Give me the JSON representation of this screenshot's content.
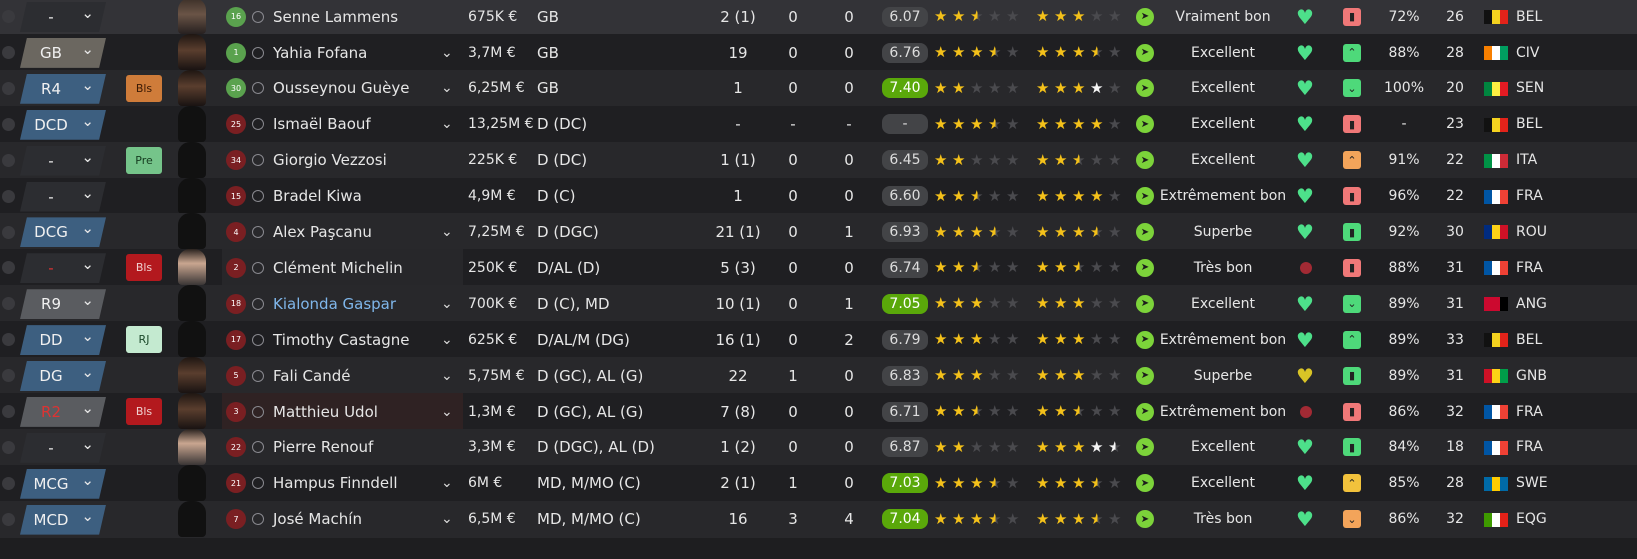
{
  "players": [
    {
      "pos": "-",
      "pos_style": "dark",
      "pos_red": false,
      "tag": "",
      "tag_style": "",
      "face": "photo",
      "shirt_no": "16",
      "gk": true,
      "name": "Senne Lammens",
      "link": false,
      "menu": false,
      "value": "675K €",
      "position": "GB",
      "apps": "2 (1)",
      "goals": "0",
      "assists": "0",
      "rating": "6.07",
      "rating_hi": false,
      "stars_ability": [
        "full",
        "full",
        "half",
        "empty",
        "empty"
      ],
      "stars_potential": [
        "full",
        "full",
        "full",
        "empty",
        "empty"
      ],
      "morale": "Vraiment bon",
      "heart": "green",
      "trend": "salmon",
      "trend_icon": "thumb-down-icon",
      "pct": "72%",
      "age": "26",
      "flag": [
        "#111111",
        "#f4d21f",
        "#e2231a"
      ],
      "nat": "BEL"
    },
    {
      "pos": "GB",
      "pos_style": "brown",
      "pos_red": false,
      "tag": "",
      "tag_style": "",
      "face": "photo2",
      "shirt_no": "1",
      "gk": true,
      "name": "Yahia Fofana",
      "link": false,
      "menu": true,
      "value": "3,7M €",
      "position": "GB",
      "apps": "19",
      "goals": "0",
      "assists": "0",
      "rating": "6.76",
      "rating_hi": false,
      "stars_ability": [
        "full",
        "full",
        "full",
        "half",
        "empty"
      ],
      "stars_potential": [
        "full",
        "full",
        "full",
        "half",
        "empty"
      ],
      "morale": "Excellent",
      "heart": "green",
      "trend": "green",
      "trend_icon": "up-icon",
      "pct": "88%",
      "age": "28",
      "flag": [
        "#f77f00",
        "#ffffff",
        "#009e60"
      ],
      "nat": "CIV"
    },
    {
      "pos": "R4",
      "pos_style": "blue",
      "pos_red": false,
      "tag": "Bls",
      "tag_style": "orange",
      "face": "photo2",
      "shirt_no": "30",
      "gk": true,
      "name": "Ousseynou Guèye",
      "link": false,
      "menu": true,
      "value": "6,25M €",
      "position": "GB",
      "apps": "1",
      "goals": "0",
      "assists": "0",
      "rating": "7.40",
      "rating_hi": true,
      "stars_ability": [
        "full",
        "full",
        "empty",
        "empty",
        "empty"
      ],
      "stars_potential": [
        "full",
        "full",
        "full",
        "white",
        "empty"
      ],
      "morale": "Excellent",
      "heart": "green",
      "trend": "green",
      "trend_icon": "down-icon",
      "pct": "100%",
      "age": "20",
      "flag": [
        "#00853f",
        "#fdef42",
        "#e31b23"
      ],
      "nat": "SEN"
    },
    {
      "pos": "DCD",
      "pos_style": "blue",
      "pos_red": false,
      "tag": "",
      "tag_style": "",
      "face": "",
      "shirt_no": "25",
      "gk": false,
      "name": "Ismaël Baouf",
      "link": false,
      "menu": true,
      "value": "13,25M €",
      "position": "D (DC)",
      "apps": "-",
      "goals": "-",
      "assists": "-",
      "rating": "-",
      "rating_hi": false,
      "stars_ability": [
        "full",
        "full",
        "full",
        "half",
        "empty"
      ],
      "stars_potential": [
        "full",
        "full",
        "full",
        "full",
        "empty"
      ],
      "morale": "Excellent",
      "heart": "green",
      "trend": "salmon",
      "trend_icon": "thumb-down-icon",
      "pct": "-",
      "age": "23",
      "flag": [
        "#111111",
        "#f4d21f",
        "#e2231a"
      ],
      "nat": "BEL"
    },
    {
      "pos": "-",
      "pos_style": "dark",
      "pos_red": false,
      "tag": "Pre",
      "tag_style": "green",
      "face": "",
      "shirt_no": "34",
      "gk": false,
      "name": "Giorgio Vezzosi",
      "link": false,
      "menu": false,
      "value": "225K €",
      "position": "D (DC)",
      "apps": "1 (1)",
      "goals": "0",
      "assists": "0",
      "rating": "6.45",
      "rating_hi": false,
      "stars_ability": [
        "full",
        "full",
        "empty",
        "empty",
        "empty"
      ],
      "stars_potential": [
        "full",
        "full",
        "half",
        "empty",
        "empty"
      ],
      "morale": "Excellent",
      "heart": "green",
      "trend": "orange",
      "trend_icon": "up-icon",
      "pct": "91%",
      "age": "22",
      "flag": [
        "#009246",
        "#ffffff",
        "#ce2b37"
      ],
      "nat": "ITA"
    },
    {
      "pos": "-",
      "pos_style": "dark",
      "pos_red": false,
      "tag": "",
      "tag_style": "",
      "face": "",
      "shirt_no": "15",
      "gk": false,
      "name": "Bradel Kiwa",
      "link": false,
      "menu": false,
      "value": "4,9M €",
      "position": "D (C)",
      "apps": "1",
      "goals": "0",
      "assists": "0",
      "rating": "6.60",
      "rating_hi": false,
      "stars_ability": [
        "full",
        "full",
        "half",
        "empty",
        "empty"
      ],
      "stars_potential": [
        "full",
        "full",
        "full",
        "full",
        "empty"
      ],
      "morale": "Extrêmement bon",
      "heart": "green",
      "trend": "salmon",
      "trend_icon": "thumb-down-icon",
      "pct": "96%",
      "age": "22",
      "flag": [
        "#0055a4",
        "#ffffff",
        "#ef4135"
      ],
      "nat": "FRA"
    },
    {
      "pos": "DCG",
      "pos_style": "blue",
      "pos_red": false,
      "tag": "",
      "tag_style": "",
      "face": "",
      "shirt_no": "4",
      "gk": false,
      "name": "Alex Paşcanu",
      "link": false,
      "menu": true,
      "value": "7,25M €",
      "position": "D (DGC)",
      "apps": "21 (1)",
      "goals": "0",
      "assists": "1",
      "rating": "6.93",
      "rating_hi": false,
      "stars_ability": [
        "full",
        "full",
        "full",
        "half",
        "empty"
      ],
      "stars_potential": [
        "full",
        "full",
        "full",
        "half",
        "empty"
      ],
      "morale": "Superbe",
      "heart": "green",
      "trend": "green",
      "trend_icon": "thumb-up-icon",
      "pct": "92%",
      "age": "30",
      "flag": [
        "#002b7f",
        "#fcd116",
        "#ce1126"
      ],
      "nat": "ROU"
    },
    {
      "pos": "-",
      "pos_style": "dark",
      "pos_red": true,
      "tag": "Bls",
      "tag_style": "red",
      "face": "photo3",
      "shirt_no": "2",
      "gk": false,
      "name": "Clément Michelin",
      "link": false,
      "menu": false,
      "value": "250K €",
      "position": "D/AL (D)",
      "apps": "5 (3)",
      "goals": "0",
      "assists": "0",
      "rating": "6.74",
      "rating_hi": false,
      "stars_ability": [
        "full",
        "full",
        "half",
        "empty",
        "empty"
      ],
      "stars_potential": [
        "full",
        "full",
        "half",
        "empty",
        "empty"
      ],
      "morale": "Très bon",
      "heart": "red",
      "trend": "salmon",
      "trend_icon": "thumb-down-icon",
      "pct": "88%",
      "age": "31",
      "flag": [
        "#0055a4",
        "#ffffff",
        "#ef4135"
      ],
      "nat": "FRA"
    },
    {
      "pos": "R9",
      "pos_style": "gray",
      "pos_red": false,
      "tag": "",
      "tag_style": "",
      "face": "",
      "shirt_no": "18",
      "gk": false,
      "name": "Kialonda Gaspar",
      "link": true,
      "menu": true,
      "value": "700K €",
      "position": "D (C), MD",
      "apps": "10 (1)",
      "goals": "0",
      "assists": "1",
      "rating": "7.05",
      "rating_hi": true,
      "stars_ability": [
        "full",
        "full",
        "full",
        "empty",
        "empty"
      ],
      "stars_potential": [
        "full",
        "full",
        "full",
        "empty",
        "empty"
      ],
      "morale": "Excellent",
      "heart": "green",
      "trend": "green",
      "trend_icon": "down-icon",
      "pct": "89%",
      "age": "31",
      "flag": [
        "#cc092f",
        "#cc092f",
        "#000000"
      ],
      "nat": "ANG"
    },
    {
      "pos": "DD",
      "pos_style": "blue",
      "pos_red": false,
      "tag": "RJ",
      "tag_style": "mint",
      "face": "",
      "shirt_no": "17",
      "gk": false,
      "name": "Timothy Castagne",
      "link": false,
      "menu": true,
      "value": "625K €",
      "position": "D/AL/M (DG)",
      "apps": "16 (1)",
      "goals": "0",
      "assists": "2",
      "rating": "6.79",
      "rating_hi": false,
      "stars_ability": [
        "full",
        "full",
        "full",
        "empty",
        "empty"
      ],
      "stars_potential": [
        "full",
        "full",
        "full",
        "empty",
        "empty"
      ],
      "morale": "Extrêmement bon",
      "heart": "green",
      "trend": "green",
      "trend_icon": "up-icon",
      "pct": "89%",
      "age": "33",
      "flag": [
        "#111111",
        "#f4d21f",
        "#e2231a"
      ],
      "nat": "BEL"
    },
    {
      "pos": "DG",
      "pos_style": "blue",
      "pos_red": false,
      "tag": "",
      "tag_style": "",
      "face": "photo2",
      "shirt_no": "5",
      "gk": false,
      "name": "Fali Candé",
      "link": false,
      "menu": true,
      "value": "5,75M €",
      "position": "D (GC), AL (G)",
      "apps": "22",
      "goals": "1",
      "assists": "0",
      "rating": "6.83",
      "rating_hi": false,
      "stars_ability": [
        "full",
        "full",
        "full",
        "empty",
        "empty"
      ],
      "stars_potential": [
        "full",
        "full",
        "full",
        "empty",
        "empty"
      ],
      "morale": "Superbe",
      "heart": "yellow",
      "trend": "green",
      "trend_icon": "thumb-up-icon",
      "pct": "89%",
      "age": "31",
      "flag": [
        "#ce1126",
        "#fcd116",
        "#009e49"
      ],
      "nat": "GNB"
    },
    {
      "pos": "R2",
      "pos_style": "gray",
      "pos_red": true,
      "tag": "Bls",
      "tag_style": "red",
      "face": "photo2",
      "shirt_no": "3",
      "gk": false,
      "name": "Matthieu Udol",
      "link": false,
      "menu": true,
      "value": "1,3M €",
      "position": "D (GC), AL (G)",
      "apps": "7 (8)",
      "goals": "0",
      "assists": "0",
      "rating": "6.71",
      "rating_hi": false,
      "stars_ability": [
        "full",
        "full",
        "half",
        "empty",
        "empty"
      ],
      "stars_potential": [
        "full",
        "full",
        "half",
        "empty",
        "empty"
      ],
      "morale": "Extrêmement bon",
      "heart": "red",
      "trend": "salmon",
      "trend_icon": "thumb-down-icon",
      "pct": "86%",
      "age": "32",
      "flag": [
        "#0055a4",
        "#ffffff",
        "#ef4135"
      ],
      "nat": "FRA"
    },
    {
      "pos": "-",
      "pos_style": "dark",
      "pos_red": false,
      "tag": "",
      "tag_style": "",
      "face": "photo3",
      "shirt_no": "22",
      "gk": false,
      "name": "Pierre Renouf",
      "link": false,
      "menu": false,
      "value": "3,3M €",
      "position": "D (DGC), AL (D)",
      "apps": "1 (2)",
      "goals": "0",
      "assists": "0",
      "rating": "6.87",
      "rating_hi": false,
      "stars_ability": [
        "full",
        "full",
        "empty",
        "empty",
        "empty"
      ],
      "stars_potential": [
        "full",
        "full",
        "full",
        "white",
        "whalf"
      ],
      "morale": "Excellent",
      "heart": "green",
      "trend": "green",
      "trend_icon": "thumb-up-icon",
      "pct": "84%",
      "age": "18",
      "flag": [
        "#0055a4",
        "#ffffff",
        "#ef4135"
      ],
      "nat": "FRA"
    },
    {
      "pos": "MCG",
      "pos_style": "blue",
      "pos_red": false,
      "tag": "",
      "tag_style": "",
      "face": "",
      "shirt_no": "21",
      "gk": false,
      "name": "Hampus Finndell",
      "link": false,
      "menu": true,
      "value": "6M €",
      "position": "MD, M/MO (C)",
      "apps": "2 (1)",
      "goals": "1",
      "assists": "0",
      "rating": "7.03",
      "rating_hi": true,
      "stars_ability": [
        "full",
        "full",
        "full",
        "half",
        "empty"
      ],
      "stars_potential": [
        "full",
        "full",
        "full",
        "half",
        "empty"
      ],
      "morale": "Excellent",
      "heart": "green",
      "trend": "yellow",
      "trend_icon": "up-icon",
      "pct": "85%",
      "age": "28",
      "flag": [
        "#006aa7",
        "#fecc00",
        "#006aa7"
      ],
      "nat": "SWE"
    },
    {
      "pos": "MCD",
      "pos_style": "blue",
      "pos_red": false,
      "tag": "",
      "tag_style": "",
      "face": "",
      "shirt_no": "7",
      "gk": false,
      "name": "José Machín",
      "link": false,
      "menu": true,
      "value": "6,5M €",
      "position": "MD, M/MO (C)",
      "apps": "16",
      "goals": "3",
      "assists": "4",
      "rating": "7.04",
      "rating_hi": true,
      "stars_ability": [
        "full",
        "full",
        "full",
        "half",
        "empty"
      ],
      "stars_potential": [
        "full",
        "full",
        "full",
        "half",
        "empty"
      ],
      "morale": "Très bon",
      "heart": "green",
      "trend": "orange",
      "trend_icon": "down-icon",
      "pct": "86%",
      "age": "32",
      "flag": [
        "#3e9a00",
        "#ffffff",
        "#e32118"
      ],
      "nat": "EQG"
    }
  ]
}
